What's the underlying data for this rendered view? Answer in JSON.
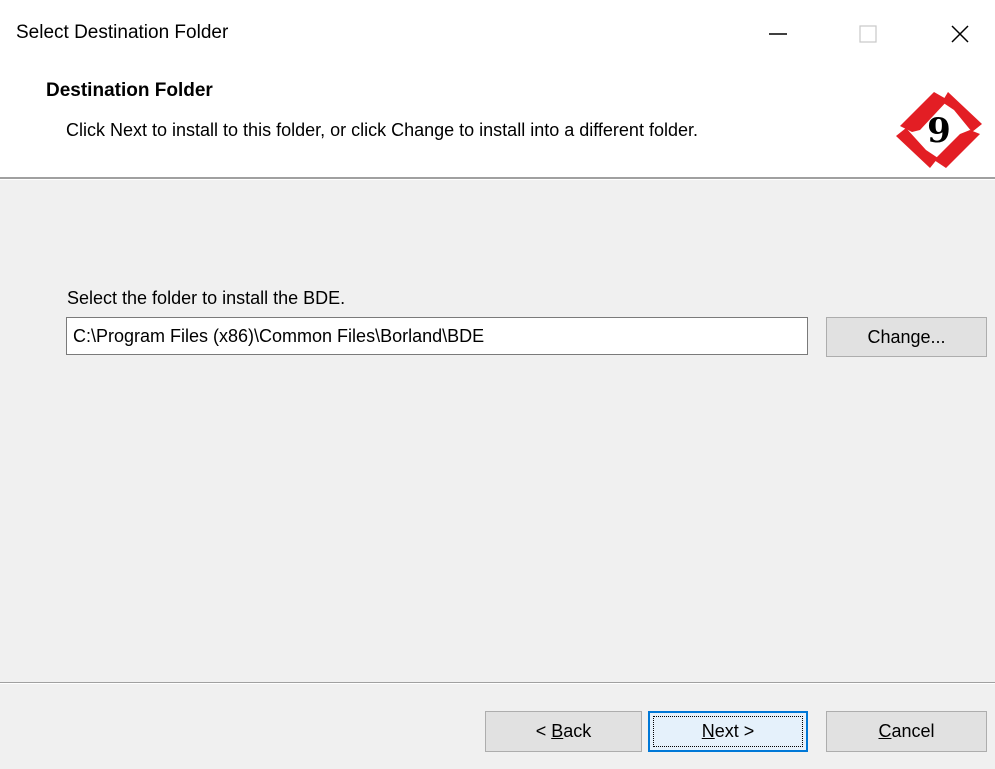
{
  "window": {
    "title": "Select Destination Folder"
  },
  "header": {
    "title": "Destination Folder",
    "subtitle": "Click Next to install to this folder, or click Change to install into a different folder.",
    "logo_digit": "9",
    "logo_color": "#e31e24"
  },
  "body": {
    "prompt": "Select the folder to install the BDE.",
    "path_value": "C:\\Program Files (x86)\\Common Files\\Borland\\BDE",
    "change_label": "Change..."
  },
  "footer": {
    "back_prefix": "< ",
    "back_mnemonic": "B",
    "back_rest": "ack",
    "next_mnemonic": "N",
    "next_rest": "ext >",
    "cancel_mnemonic": "C",
    "cancel_rest": "ancel"
  },
  "icons": {
    "minimize": "minimize-icon",
    "maximize": "maximize-icon",
    "close": "close-icon",
    "logo": "brand-logo-icon"
  },
  "colors": {
    "accent": "#0078d7",
    "face": "#f0f0f0",
    "button": "#e1e1e1"
  }
}
